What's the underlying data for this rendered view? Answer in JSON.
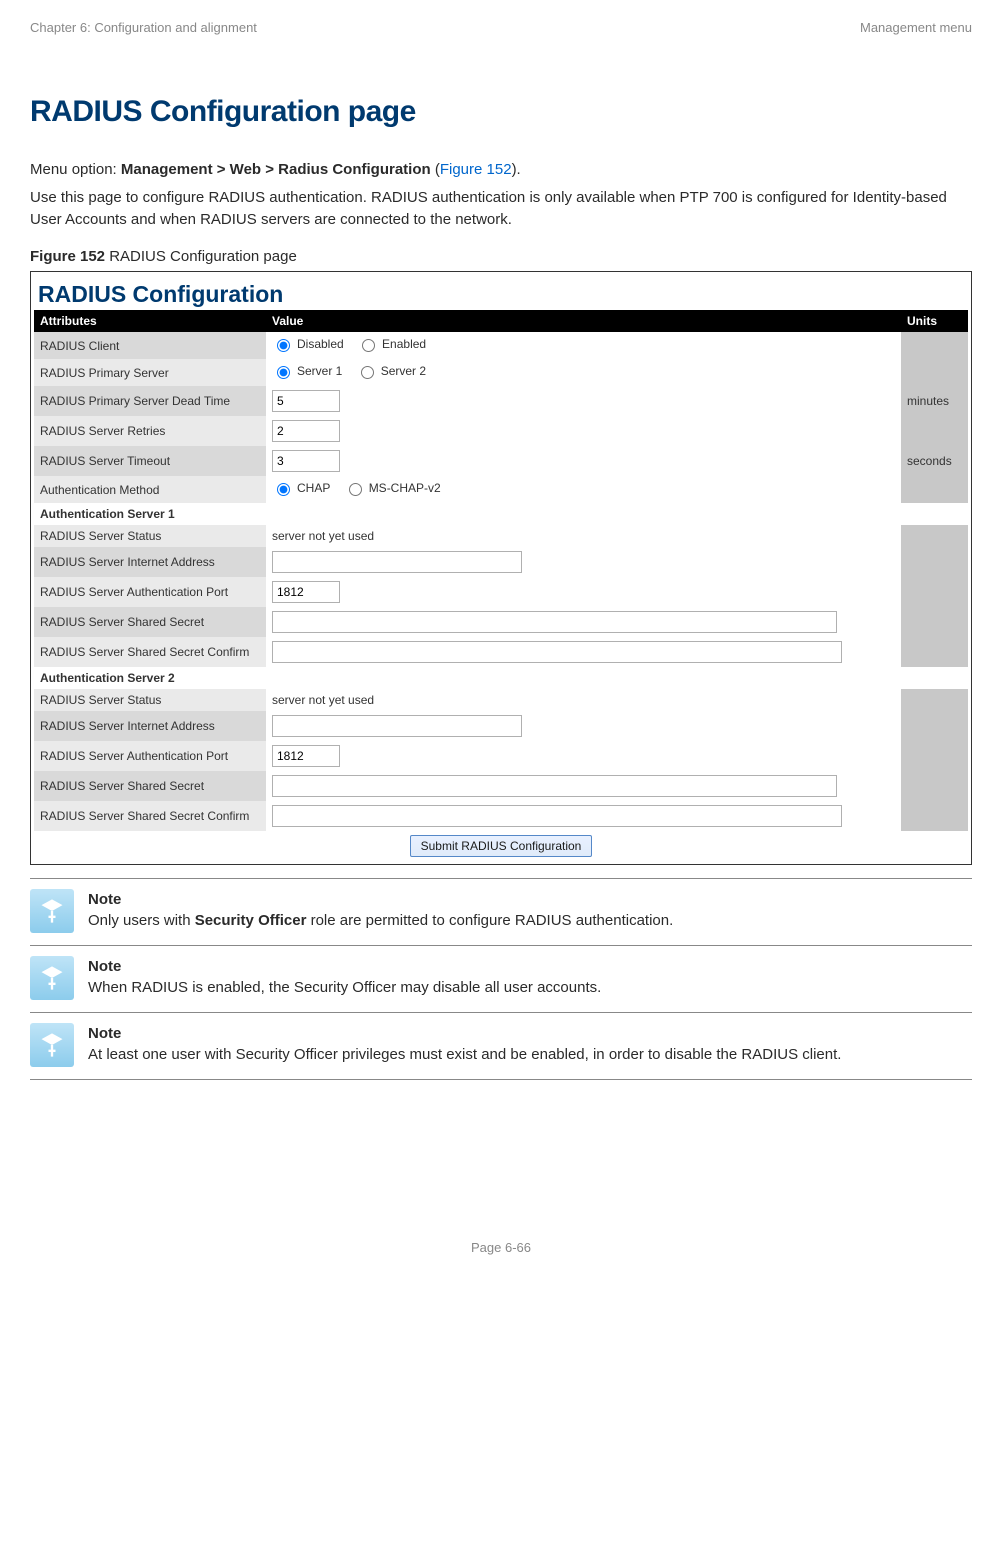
{
  "header": {
    "left": "Chapter 6:  Configuration and alignment",
    "right": "Management menu"
  },
  "title": "RADIUS Configuration page",
  "intro1_pre": "Menu option: ",
  "intro1_bold": "Management > Web > Radius Configuration",
  "intro1_open": " (",
  "intro1_link": "Figure 152",
  "intro1_close": ").",
  "intro2": "Use this page to configure RADIUS authentication. RADIUS authentication is only available when PTP 700 is configured for Identity-based User Accounts and when RADIUS servers are connected to the network.",
  "figure_label_bold": "Figure 152",
  "figure_label_rest": "  RADIUS Configuration page",
  "config": {
    "panel_title": "RADIUS Configuration",
    "col_attr": "Attributes",
    "col_value": "Value",
    "col_units": "Units",
    "rows": {
      "client_label": "RADIUS Client",
      "client_opt1": "Disabled",
      "client_opt2": "Enabled",
      "primary_label": "RADIUS Primary Server",
      "primary_opt1": "Server 1",
      "primary_opt2": "Server 2",
      "deadtime_label": "RADIUS Primary Server Dead Time",
      "deadtime_value": "5",
      "deadtime_units": "minutes",
      "retries_label": "RADIUS Server Retries",
      "retries_value": "2",
      "timeout_label": "RADIUS Server Timeout",
      "timeout_value": "3",
      "timeout_units": "seconds",
      "authm_label": "Authentication Method",
      "authm_opt1": "CHAP",
      "authm_opt2": "MS-CHAP-v2",
      "sub1": "Authentication Server 1",
      "status_label": "RADIUS Server Status",
      "status_value": "server not yet used",
      "addr_label": "RADIUS Server Internet Address",
      "port_label": "RADIUS Server Authentication Port",
      "port_value": "1812",
      "secret_label": "RADIUS Server Shared Secret",
      "secretc_label": "RADIUS Server Shared Secret Confirm",
      "sub2": "Authentication Server 2",
      "submit": "Submit RADIUS Configuration"
    }
  },
  "notes": [
    {
      "title": "Note",
      "pre": "Only users with ",
      "bold": "Security Officer",
      "post": " role are permitted to configure RADIUS authentication."
    },
    {
      "title": "Note",
      "pre": "When RADIUS is enabled, the Security Officer may disable all user accounts.",
      "bold": "",
      "post": ""
    },
    {
      "title": "Note",
      "pre": "At least one user with Security Officer privileges must exist and be enabled, in order to disable the RADIUS client.",
      "bold": "",
      "post": ""
    }
  ],
  "footer": "Page 6-66"
}
